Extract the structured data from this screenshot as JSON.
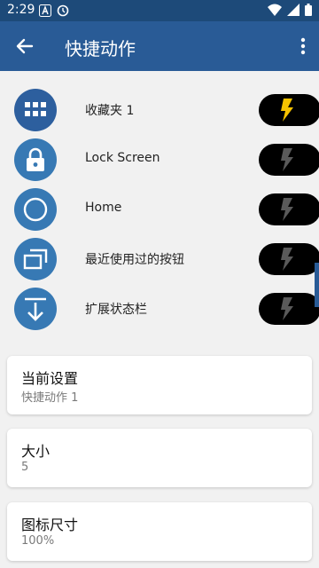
{
  "status_bar": {
    "time": "2:29"
  },
  "app_bar": {
    "title": "快捷动作"
  },
  "actions": [
    {
      "label": "收藏夹 1",
      "icon": "grid-icon",
      "flash_active": true
    },
    {
      "label": "Lock Screen",
      "icon": "lock-icon",
      "flash_active": false
    },
    {
      "label": "Home",
      "icon": "circle-icon",
      "flash_active": false
    },
    {
      "label": "最近使用过的按钮",
      "icon": "recents-icon",
      "flash_active": false
    },
    {
      "label": "扩展状态栏",
      "icon": "expand-down-icon",
      "flash_active": false
    }
  ],
  "settings": [
    {
      "title": "当前设置",
      "value": "快捷动作 1"
    },
    {
      "title": "大小",
      "value": "5"
    },
    {
      "title": "图标尺寸",
      "value": "100%"
    }
  ],
  "colors": {
    "status_bar": "#1d4a79",
    "app_bar": "#295b96",
    "icon_circle": "#3779b4",
    "flash_active": "#f6c300",
    "flash_inactive": "#5a5a5a"
  }
}
